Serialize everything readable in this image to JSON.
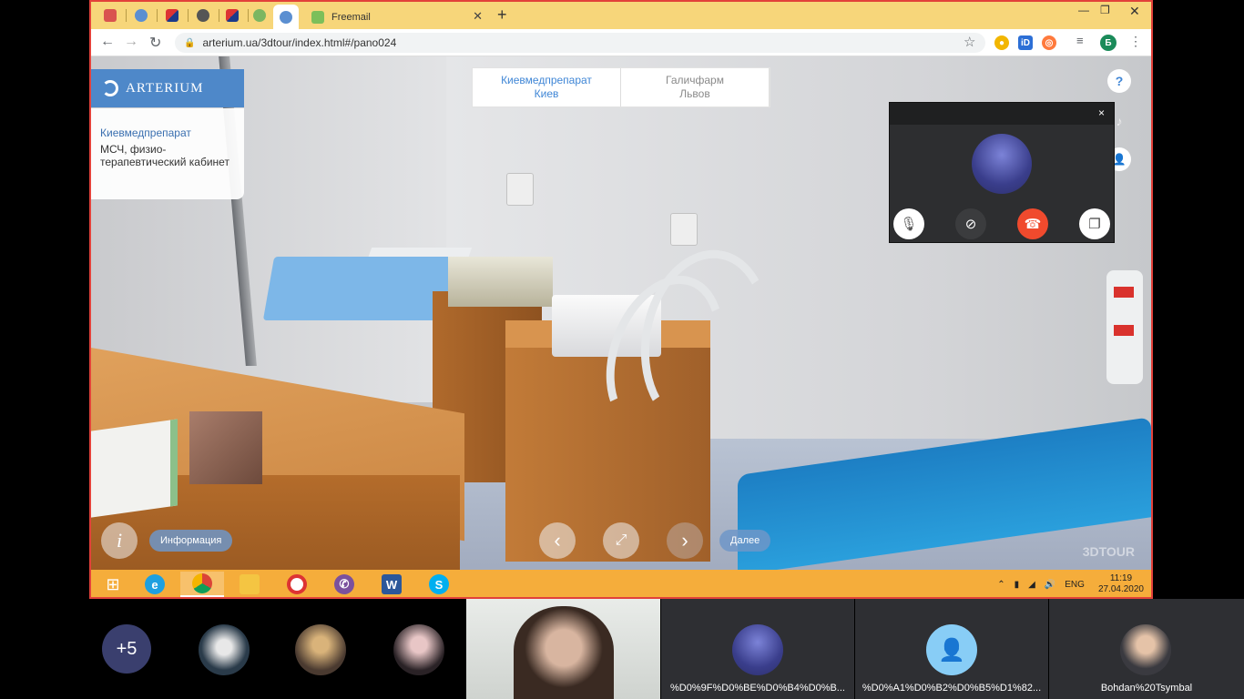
{
  "browser": {
    "active_tab_favicon": "arterium-icon",
    "tab_freemail_title": "Freemail",
    "new_tab_symbol": "+",
    "url": "arterium.ua/3dtour/index.html#/pano024",
    "profile_initial": "Б"
  },
  "tour": {
    "brand": "ARTERIUM",
    "info_card": {
      "title": "Киевмедпрепарат",
      "description": "МСЧ, физио-терапевтический кабинет"
    },
    "locations": [
      {
        "line1": "Киевмедпрепарат",
        "line2": "Киев",
        "active": true
      },
      {
        "line1": "Галичфарм",
        "line2": "Львов",
        "active": false
      }
    ],
    "side_buttons": {
      "help": "?",
      "music": "♪",
      "user": "👤"
    },
    "bottom": {
      "info_button": "i",
      "info_label": "Информация",
      "next_label": "Далее",
      "watermark": "3DTOUR"
    }
  },
  "call": {
    "close": "×"
  },
  "taskbar": {
    "tray_lang": "ENG",
    "time": "11:19",
    "date": "27.04.2020"
  },
  "participants": {
    "more_count": "+5",
    "names": [
      "%D0%9F%D0%BE%D0%B4%D0%B...",
      "%D0%A1%D0%B2%D0%B5%D1%82...",
      "Bohdan%20Tsymbal"
    ]
  },
  "colors": {
    "frame_border": "#e2413a",
    "tab_strip": "#f7d67a",
    "taskbar": "#f5ad3b",
    "brand_blue": "#4e88c9",
    "end_call_red": "#f04a2d"
  }
}
